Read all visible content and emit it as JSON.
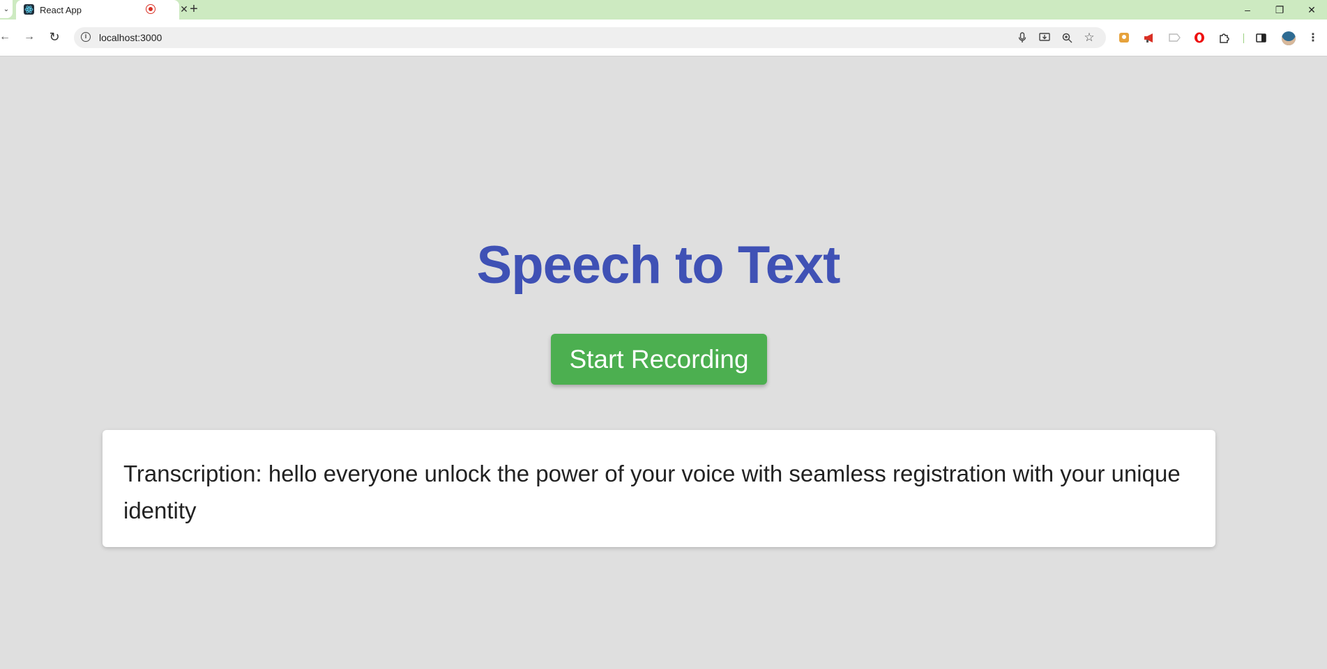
{
  "browser": {
    "tab": {
      "title": "React App",
      "close_glyph": "✕",
      "new_tab_glyph": "+"
    },
    "window_controls": {
      "minimize": "–",
      "restore": "❐",
      "close": "✕"
    },
    "toolbar": {
      "back_glyph": "←",
      "forward_glyph": "→",
      "reload_glyph": "↻",
      "url": "localhost:3000"
    },
    "icons": [
      "microphone-icon",
      "install-icon",
      "zoom-icon",
      "bookmark-star-icon",
      "extension-1-icon",
      "megaphone-icon",
      "tag-icon",
      "opera-icon",
      "puzzle-extensions-icon",
      "side-panel-icon",
      "avatar",
      "menu-icon"
    ]
  },
  "page": {
    "title": "Speech to Text",
    "record_button_label": "Start Recording",
    "transcription_text": "Transcription: hello everyone unlock the power of your voice with seamless registration with your unique identity"
  },
  "colors": {
    "tabstrip": "#cdeac1",
    "page_bg": "#dfdfdf",
    "title": "#3f51b5",
    "button": "#4caf50",
    "recording_indicator": "#d93025"
  }
}
